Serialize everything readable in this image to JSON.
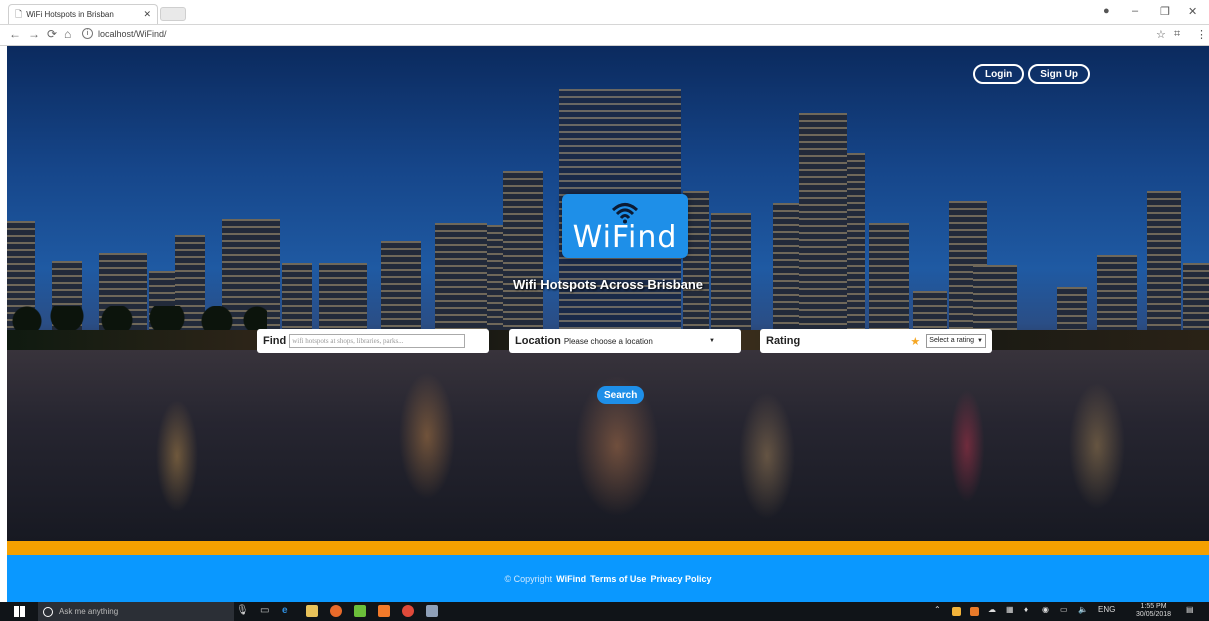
{
  "browser": {
    "tab_title": "WiFi Hotspots in Brisban",
    "url": "localhost/WiFind/"
  },
  "header": {
    "login_label": "Login",
    "signup_label": "Sign Up"
  },
  "hero": {
    "logo_text": "WiFind",
    "tagline": "Wifi Hotspots Across Brisbane"
  },
  "search": {
    "find_label": "Find",
    "find_placeholder": "wifi hotspots at shops, libraries, parks...",
    "location_label": "Location",
    "location_value": "Please choose a location",
    "rating_label": "Rating",
    "rating_value": "Select a rating",
    "search_label": "Search"
  },
  "footer": {
    "copyright": "© Copyright",
    "brand": "WiFind",
    "terms": "Terms of Use",
    "privacy": "Privacy Policy"
  },
  "taskbar": {
    "search_placeholder": "Ask me anything",
    "language": "ENG",
    "time": "1:55 PM",
    "date": "30/05/2018"
  },
  "colors": {
    "brand_blue": "#1e8fe8",
    "footer_blue": "#0a98ff",
    "footer_orange": "#f5a000",
    "star": "#f5a623"
  }
}
